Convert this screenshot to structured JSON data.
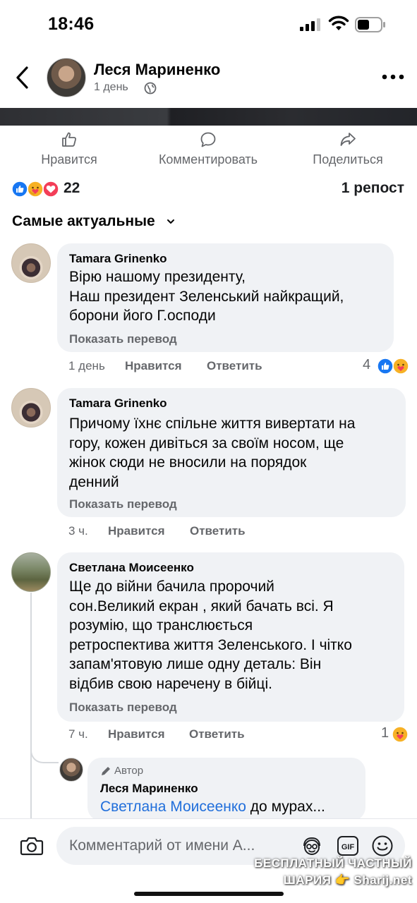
{
  "status": {
    "time": "18:46"
  },
  "post": {
    "author": "Леся Мариненко",
    "time": "1 день"
  },
  "actions": {
    "like": "Нравится",
    "comment": "Комментировать",
    "share": "Поделиться"
  },
  "reactions": {
    "count": "22",
    "reposts": "1 репост"
  },
  "sort": {
    "label": "Самые актуальные"
  },
  "comments": [
    {
      "name": "Tamara Grinenko",
      "text": "Вірю нашому президенту,\nНаш президент Зеленський найкращий,\nборони його Г.осподи",
      "translate": "Показать перевод",
      "time": "1 день",
      "like": "Нравится",
      "reply": "Ответить",
      "reaction_count": "4"
    },
    {
      "name": "Tamara Grinenko",
      "text": "Причому їхнє спільне життя вивертати на\nгору, кожен дивіться за своїм носом, ще\nжінок сюди не вносили на порядок\nденний",
      "translate": "Показать перевод",
      "time": "3 ч.",
      "like": "Нравится",
      "reply": "Ответить"
    },
    {
      "name": "Светлана Моисеенко",
      "text": "Ще до війни бачила пророчий\nсон.Великий екран , який бачать всі. Я\nрозумію, що транслюється\nретроспектива життя Зеленського. І чітко\nзапам'ятовую лише одну деталь: Він\nвідбив свою наречену в бійці.",
      "translate": "Показать перевод",
      "time": "7 ч.",
      "like": "Нравится",
      "reply": "Ответить",
      "reaction_count": "1"
    }
  ],
  "reply": {
    "badge": "Автор",
    "name": "Леся Мариненко",
    "mention": "Светлана Моисеенко",
    "text": " до мурах..."
  },
  "composer": {
    "placeholder": "Комментарий от имени А..."
  },
  "watermark": {
    "line1": "БЕСПЛАТНЫЙ ЧАСТНЫЙ",
    "line2": "ШАРИЯ 👉 Sharij.net"
  },
  "icons": {
    "back": "chevron-left-icon",
    "more": "more-horizontal-icon",
    "globe": "globe-icon",
    "like": "thumbs-up-icon",
    "comment": "comment-icon",
    "share": "share-arrow-icon",
    "reactions": [
      "like-reaction-icon",
      "care-reaction-icon",
      "love-reaction-icon"
    ],
    "camera": "camera-icon",
    "avatar_sticker": "avatar-sticker-icon",
    "gif": "gif-icon",
    "emoji": "emoji-icon"
  },
  "colors": {
    "link": "#216fdb",
    "like_blue": "#1877f2",
    "love_red": "#f33e58",
    "care_yellow": "#f7b125",
    "secondary_text": "#65676b",
    "bubble": "#f0f2f5"
  }
}
